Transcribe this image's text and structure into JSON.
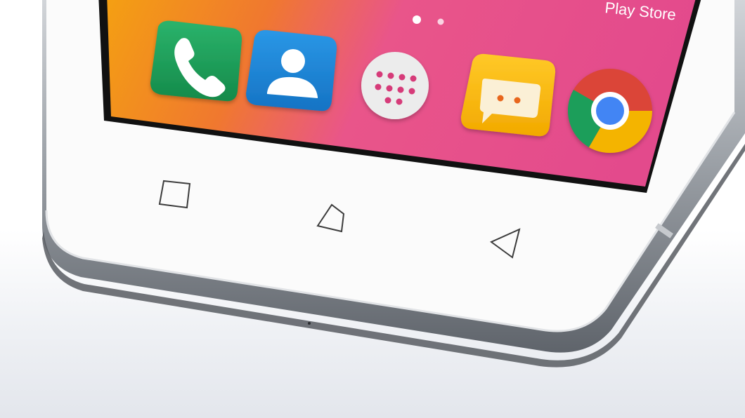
{
  "home_screen": {
    "partial_label": "Play Store",
    "page_indicator": {
      "pages": 2,
      "active_page": 1
    },
    "dock_icons": [
      {
        "name": "phone-icon",
        "color": "#1e9e5a"
      },
      {
        "name": "contacts-icon",
        "color": "#1f88d8"
      },
      {
        "name": "app-drawer-icon",
        "color": "#e9e9e9"
      },
      {
        "name": "messaging-icon",
        "color": "#f4b400"
      },
      {
        "name": "chrome-icon",
        "color": "#4285f4"
      }
    ]
  },
  "navigation_keys": [
    {
      "name": "recent-apps-key-icon",
      "shape": "square"
    },
    {
      "name": "home-key-icon",
      "shape": "house"
    },
    {
      "name": "back-key-icon",
      "shape": "triangle-left"
    }
  ],
  "colors": {
    "wallpaper_orange": "#f39a18",
    "wallpaper_pink": "#e8508e",
    "bezel": "#fbfbfb",
    "frame": "#a9adb3"
  }
}
